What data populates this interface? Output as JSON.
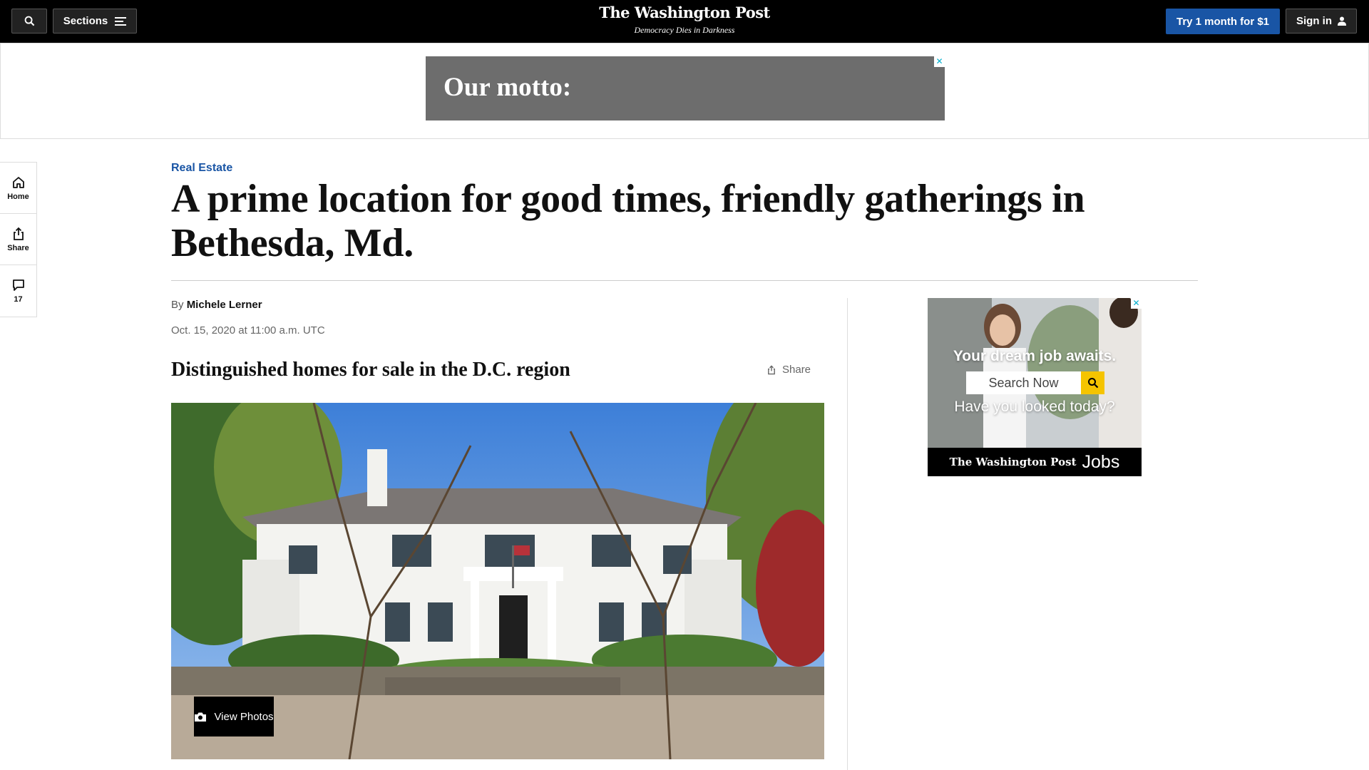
{
  "header": {
    "sections_label": "Sections",
    "logo_name": "The Washington Post",
    "logo_motto": "Democracy Dies in Darkness",
    "subscribe_label": "Try 1 month for $1",
    "signin_label": "Sign in"
  },
  "top_ad": {
    "text": "Our motto:",
    "close_glyph": "✕"
  },
  "rail": {
    "home_label": "Home",
    "share_label": "Share",
    "comments_count": "17"
  },
  "article": {
    "kicker": "Real Estate",
    "headline": "A prime location for good times, friendly gatherings in Bethesda, Md.",
    "by": "By",
    "author": "Michele Lerner",
    "date": "Oct. 15, 2020 at 11:00 a.m. UTC"
  },
  "gallery": {
    "title": "Distinguished homes for sale in the D.C. region",
    "share_label": "Share",
    "view_photos_label": "View Photos"
  },
  "side_ad": {
    "headline": "Your dream job awaits.",
    "search_label": "Search Now",
    "question": "Have you looked today?",
    "brand": "The Washington Post",
    "jobs": "Jobs",
    "close_glyph": "✕"
  },
  "colors": {
    "accent_blue": "#1955a5",
    "header_bg": "#000000",
    "ad_gray": "#6d6d6d",
    "ad_yellow": "#f5c400"
  }
}
